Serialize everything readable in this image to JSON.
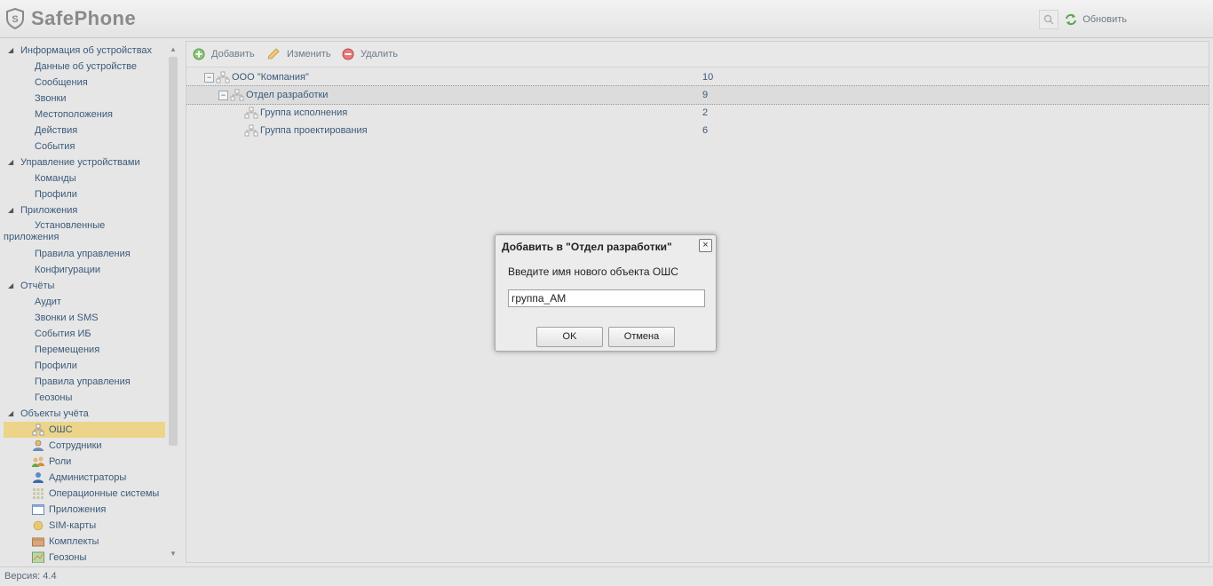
{
  "app": {
    "title": "SafePhone"
  },
  "header": {
    "refresh_label": "Обновить"
  },
  "sidebar": {
    "groups": [
      {
        "label": "Информация об устройствах",
        "items": [
          "Данные об устройстве",
          "Сообщения",
          "Звонки",
          "Местоположения",
          "Действия",
          "События"
        ]
      },
      {
        "label": "Управление устройствами",
        "items": [
          "Команды",
          "Профили"
        ]
      },
      {
        "label": "Приложения",
        "items": [
          "Установленные приложения",
          "Правила управления",
          "Конфигурации"
        ]
      },
      {
        "label": "Отчёты",
        "items": [
          "Аудит",
          "Звонки и SMS",
          "События ИБ",
          "Перемещения",
          "Профили",
          "Правила управления",
          "Геозоны"
        ]
      },
      {
        "label": "Объекты учёта",
        "items": [
          "ОШС",
          "Сотрудники",
          "Роли",
          "Администраторы",
          "Операционные системы",
          "Приложения",
          "SIM-карты",
          "Комплекты",
          "Геозоны"
        ]
      }
    ],
    "selected": "ОШС"
  },
  "toolbar": {
    "add_label": "Добавить",
    "edit_label": "Изменить",
    "delete_label": "Удалить"
  },
  "tree": [
    {
      "name": "ООО \"Компания\"",
      "count": "10",
      "expanded": true
    },
    {
      "name": "Отдел разработки",
      "count": "9",
      "expanded": true,
      "selected": true
    },
    {
      "name": "Группа исполнения",
      "count": "2"
    },
    {
      "name": "Группа проектирования",
      "count": "6"
    }
  ],
  "dialog": {
    "title": "Добавить в \"Отдел разработки\"",
    "prompt": "Введите имя нового объекта ОШС",
    "input_value": "группа_АМ",
    "ok_label": "OK",
    "cancel_label": "Отмена"
  },
  "footer": {
    "version": "Версия: 4.4"
  },
  "colors": {
    "accent_selected": "#ecd58a",
    "text": "#3a5a7a"
  }
}
